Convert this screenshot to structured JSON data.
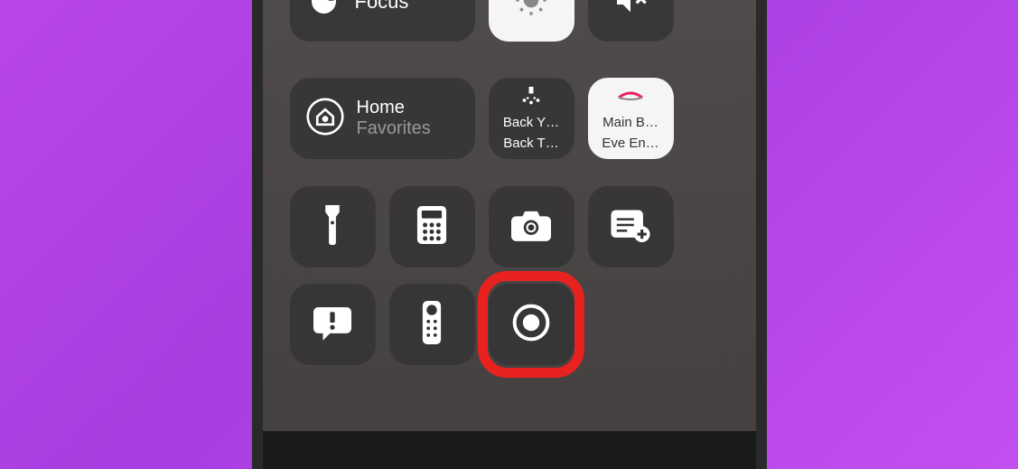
{
  "focus": {
    "label": "Focus"
  },
  "home": {
    "title": "Home",
    "subtitle": "Favorites"
  },
  "scene1": {
    "line1": "Back Y…",
    "line2": "Back T…"
  },
  "scene2": {
    "line1": "Main B…",
    "line2": "Eve En…"
  },
  "highlighted_control": "screen-recording"
}
